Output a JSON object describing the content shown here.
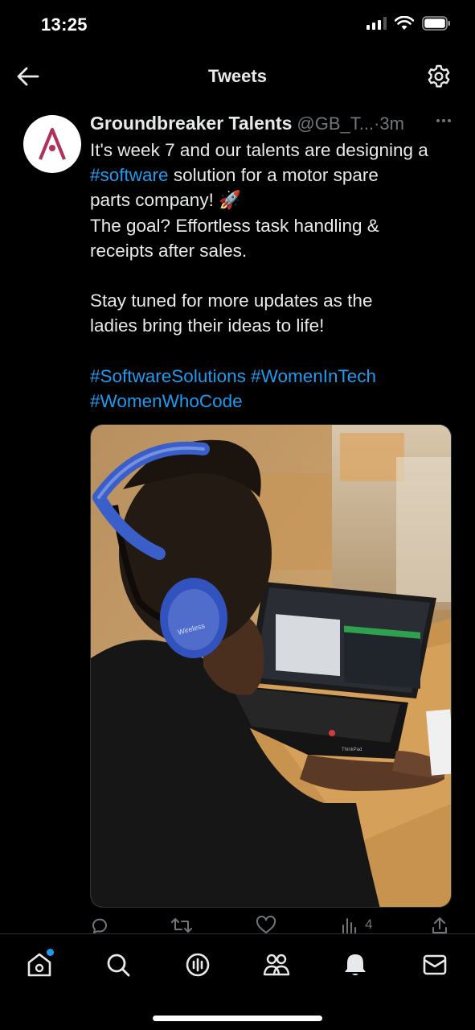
{
  "status_bar": {
    "time": "13:25"
  },
  "header": {
    "title": "Tweets",
    "back_icon": "arrow-left-icon",
    "settings_icon": "gear-icon"
  },
  "tweet": {
    "author_name": "Groundbreaker Talents",
    "author_handle": "@GB_T...",
    "time_separator": " · ",
    "time": "3m",
    "body_lines": [
      {
        "parts": [
          {
            "text": "It's week 7 and our talents are designing a",
            "tag": false
          }
        ]
      },
      {
        "parts": [
          {
            "text": "#software",
            "tag": true
          },
          {
            "text": " solution for a motor spare",
            "tag": false
          }
        ]
      },
      {
        "parts": [
          {
            "text": "parts company! 🚀",
            "tag": false
          }
        ]
      },
      {
        "parts": [
          {
            "text": "The goal? Effortless task handling &",
            "tag": false
          }
        ]
      },
      {
        "parts": [
          {
            "text": "receipts after sales.",
            "tag": false
          }
        ]
      },
      {
        "parts": [
          {
            "text": "",
            "tag": false
          }
        ]
      },
      {
        "parts": [
          {
            "text": "Stay tuned for more updates as the",
            "tag": false
          }
        ]
      },
      {
        "parts": [
          {
            "text": "ladies bring their ideas to life!",
            "tag": false
          }
        ]
      },
      {
        "parts": [
          {
            "text": "",
            "tag": false
          }
        ]
      },
      {
        "parts": [
          {
            "text": "#SoftwareSolutions",
            "tag": true
          },
          {
            "text": " ",
            "tag": false
          },
          {
            "text": "#WomenInTech",
            "tag": true
          }
        ]
      },
      {
        "parts": [
          {
            "text": "#WomenWhoCode",
            "tag": true
          }
        ]
      }
    ],
    "media_alt_icon": "photo",
    "headphone_text": "Wireless",
    "laptop_brand": "ThinkPad",
    "actions": {
      "views_count": "4"
    }
  },
  "colors": {
    "background": "#000000",
    "text": "#e7e9ea",
    "muted": "#71767b",
    "link": "#1d9bf0",
    "avatar_logo": "#b0315a"
  },
  "tabbar": {
    "items": [
      "home-icon",
      "search-icon",
      "spaces-icon",
      "communities-icon",
      "notifications-icon",
      "messages-icon"
    ]
  }
}
